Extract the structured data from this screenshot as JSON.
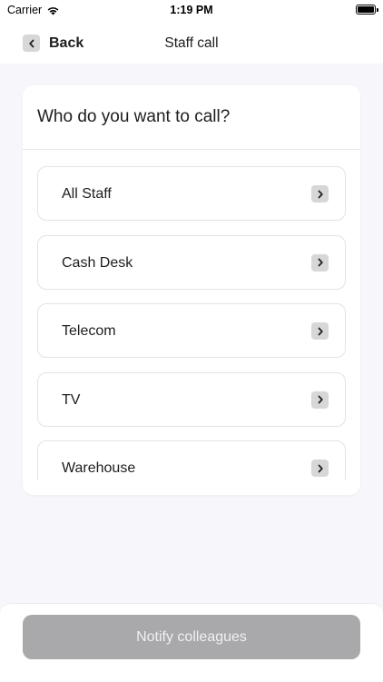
{
  "status_bar": {
    "carrier": "Carrier",
    "time": "1:19 PM"
  },
  "nav": {
    "back_label": "Back",
    "title": "Staff call"
  },
  "card": {
    "heading": "Who do you want to call?",
    "options": [
      {
        "label": "All Staff"
      },
      {
        "label": "Cash Desk"
      },
      {
        "label": "Telecom"
      },
      {
        "label": "TV"
      },
      {
        "label": "Warehouse"
      }
    ]
  },
  "footer": {
    "notify_label": "Notify colleagues"
  },
  "colors": {
    "page_background": "#f6f6fb",
    "button_disabled": "#a9a9ab",
    "chevron_badge": "#d7d7d9"
  }
}
